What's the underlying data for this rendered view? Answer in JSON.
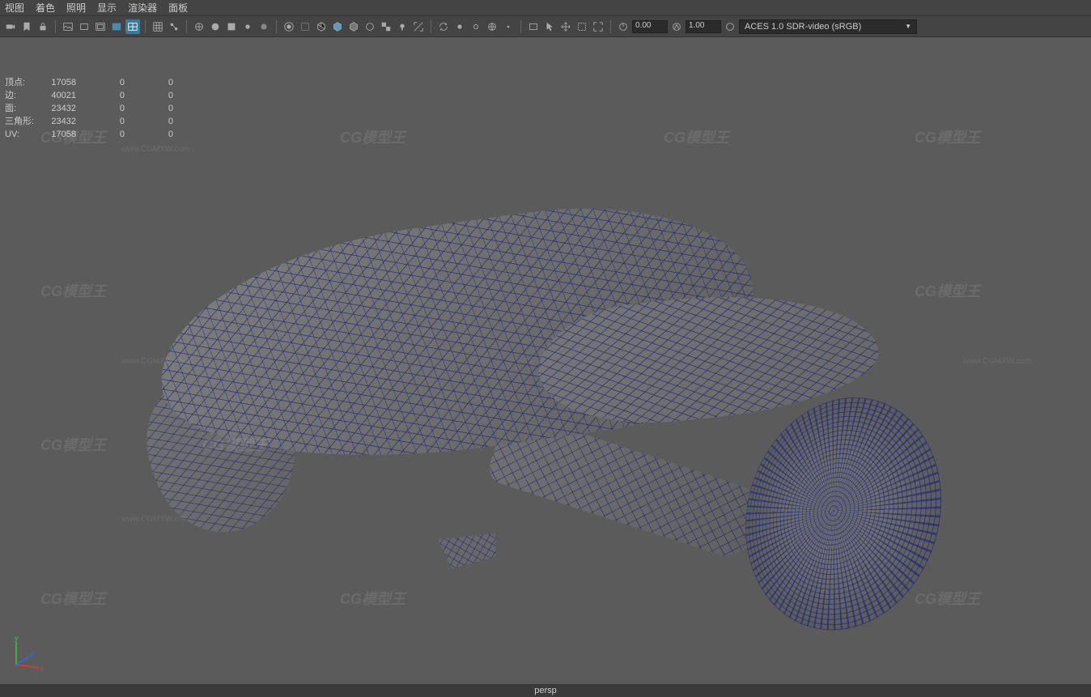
{
  "menu": {
    "items": [
      "视图",
      "着色",
      "照明",
      "显示",
      "渲染器",
      "面板"
    ]
  },
  "toolbar": {
    "input1_value": "0.00",
    "input2_value": "1.00",
    "colorspace_label": "ACES 1.0 SDR-video (sRGB)"
  },
  "stats": {
    "rows": [
      {
        "label": "顶点:",
        "c1": "17058",
        "c2": "0",
        "c3": "0"
      },
      {
        "label": "边:",
        "c1": "40021",
        "c2": "0",
        "c3": "0"
      },
      {
        "label": "面:",
        "c1": "23432",
        "c2": "0",
        "c3": "0"
      },
      {
        "label": "三角形:",
        "c1": "23432",
        "c2": "0",
        "c3": "0"
      },
      {
        "label": "UV:",
        "c1": "17058",
        "c2": "0",
        "c3": "0"
      }
    ]
  },
  "axis": {
    "x": "x",
    "y": "y",
    "z": "z"
  },
  "status": {
    "camera": "persp"
  },
  "watermark_text": "CG模型王",
  "watermark_url": "www.CGMXW.com"
}
